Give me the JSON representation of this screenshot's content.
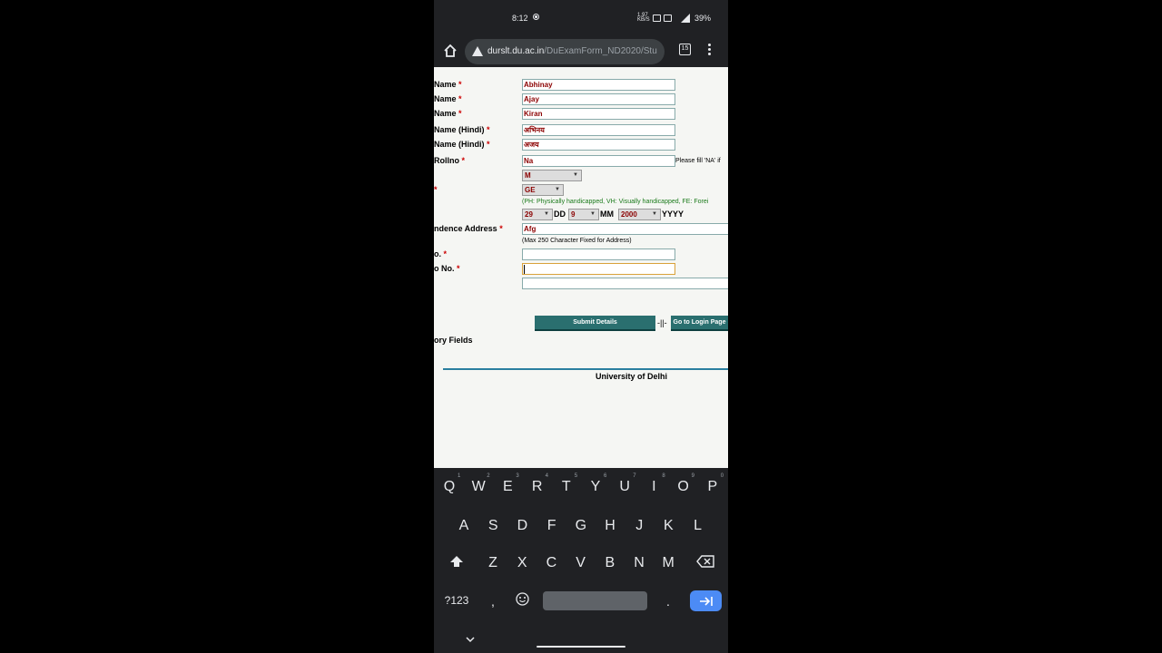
{
  "status_bar": {
    "time": "8:12",
    "net_speed_top": "1.97",
    "net_speed_unit": "KB/S",
    "battery": "39%"
  },
  "browser": {
    "url_host": "durslt.du.ac.in",
    "url_path": "/DuExamForm_ND2020/Stu",
    "tab_count": "15"
  },
  "form": {
    "fields": [
      {
        "label": "Name",
        "value": "Abhinay"
      },
      {
        "label": "Name",
        "value": "Ajay"
      },
      {
        "label": "Name",
        "value": "Kiran"
      },
      {
        "label": "Name (Hindi)",
        "value": "अभिनय"
      },
      {
        "label": "Name (Hindi)",
        "value": "अजय"
      },
      {
        "label": "Rollno",
        "value": "Na"
      }
    ],
    "rollno_hint": "Please fill 'NA' if",
    "gender_value": "M",
    "category_value": "GE",
    "category_note": "(PH: Physically handicapped, VH: Visually handicapped, FE: Forei",
    "dob": {
      "day": "29",
      "day_label": "DD",
      "month": "9",
      "month_label": "MM",
      "year": "2000",
      "year_label": "YYYY"
    },
    "address_label": "ndence Address",
    "address_value": "Afg",
    "address_note": "(Max 250 Character Fixed for Address)",
    "mobile_label": "o.",
    "phone_label": "o No.",
    "mandatory_label": "ory Fields",
    "submit_label": "Submit Details",
    "separator": "-||-",
    "login_label": "Go to Login Page",
    "footer": "University of Delhi"
  },
  "keyboard": {
    "row1": [
      "Q",
      "W",
      "E",
      "R",
      "T",
      "Y",
      "U",
      "I",
      "O",
      "P"
    ],
    "row1_hints": [
      "1",
      "2",
      "3",
      "4",
      "5",
      "6",
      "7",
      "8",
      "9",
      "0"
    ],
    "row2": [
      "A",
      "S",
      "D",
      "F",
      "G",
      "H",
      "J",
      "K",
      "L"
    ],
    "row3": [
      "Z",
      "X",
      "C",
      "V",
      "B",
      "N",
      "M"
    ],
    "symbols_label": "?123",
    "comma": ",",
    "period": "."
  }
}
